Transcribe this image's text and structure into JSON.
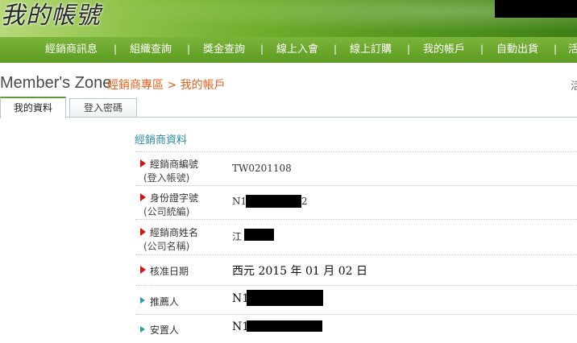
{
  "header": {
    "title": "我的帳號"
  },
  "nav": {
    "items": [
      {
        "id": "dealer-info",
        "label": "經銷商訊息"
      },
      {
        "id": "org-query",
        "label": "組織查詢"
      },
      {
        "id": "bonus-query",
        "label": "獎金查詢"
      },
      {
        "id": "online-join",
        "label": "線上入會"
      },
      {
        "id": "online-order",
        "label": "線上訂購"
      },
      {
        "id": "my-account",
        "label": "我的帳戶"
      },
      {
        "id": "auto-ship",
        "label": "自動出貨"
      },
      {
        "id": "more",
        "label": "活"
      }
    ],
    "separator": "|"
  },
  "zone": {
    "title": "Member's Zone",
    "breadcrumb": "經銷商專區 > 我的帳戶",
    "right_glyph": "活"
  },
  "tabs": [
    {
      "id": "my-profile",
      "label": "我的資料",
      "active": true
    },
    {
      "id": "login-password",
      "label": "登入密碼",
      "active": false
    }
  ],
  "section": {
    "title": "經銷商資料",
    "rows": [
      {
        "label": "經銷商編號",
        "sublabel": "(登入帳號)",
        "value": "TW0201108",
        "marker": "red"
      },
      {
        "label": "身份證字號",
        "sublabel": "(公司統編)",
        "value_prefix": "N1",
        "value_suffix": "2",
        "marker": "red"
      },
      {
        "label": "經銷商姓名",
        "sublabel": "(公司名稱)",
        "value_prefix": "江",
        "marker": "red"
      },
      {
        "label": "核准日期",
        "value": "西元 2015 年 01 月 02 日",
        "marker": "red"
      },
      {
        "label": "推薦人",
        "value_prefix": "N1",
        "marker": "teal"
      },
      {
        "label": "安置人",
        "value_prefix": "N1",
        "marker": "teal"
      }
    ]
  },
  "colors": {
    "accent_green": "#68a52a",
    "breadcrumb_orange": "#e0621d",
    "section_teal": "#2a8aa6",
    "marker_red": "#d41515"
  }
}
